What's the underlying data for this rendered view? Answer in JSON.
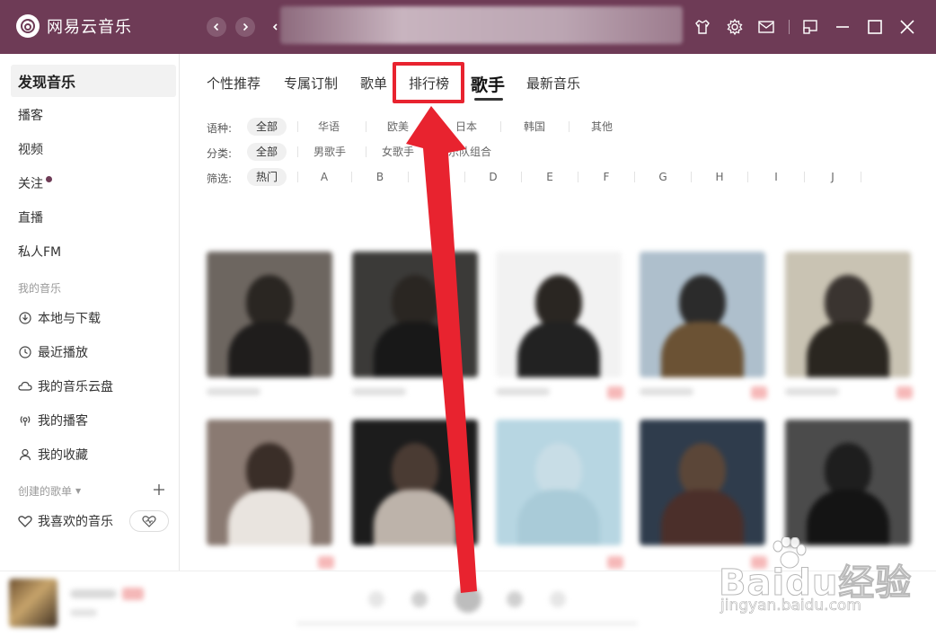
{
  "app": {
    "title": "网易云音乐"
  },
  "titlebar": {
    "icons": [
      "back-icon",
      "forward-icon",
      "skin-icon",
      "gear-icon",
      "mail-icon",
      "mini-mode-icon",
      "minimize-icon",
      "maximize-icon",
      "close-icon"
    ]
  },
  "sidebar": {
    "discover": "发现音乐",
    "items": [
      {
        "label": "播客"
      },
      {
        "label": "视频"
      },
      {
        "label": "关注"
      },
      {
        "label": "直播"
      },
      {
        "label": "私人FM"
      }
    ],
    "my_music_header": "我的音乐",
    "my_music": [
      {
        "label": "本地与下载",
        "icon": "download-icon"
      },
      {
        "label": "最近播放",
        "icon": "clock-icon"
      },
      {
        "label": "我的音乐云盘",
        "icon": "cloud-icon"
      },
      {
        "label": "我的播客",
        "icon": "podcast-icon"
      },
      {
        "label": "我的收藏",
        "icon": "person-icon"
      }
    ],
    "playlists_header": "创建的歌单",
    "favorite": "我喜欢的音乐"
  },
  "tabs": [
    {
      "label": "个性推荐"
    },
    {
      "label": "专属订制"
    },
    {
      "label": "歌单"
    },
    {
      "label": "排行榜"
    },
    {
      "label": "歌手"
    },
    {
      "label": "最新音乐"
    }
  ],
  "active_tab": "歌手",
  "highlighted_tab": "排行榜",
  "filters": {
    "language": {
      "label": "语种:",
      "options": [
        "全部",
        "华语",
        "欧美",
        "日本",
        "韩国",
        "其他"
      ]
    },
    "category": {
      "label": "分类:",
      "options": [
        "全部",
        "男歌手",
        "女歌手",
        "乐队组合"
      ]
    },
    "filter": {
      "label": "筛选:",
      "options": [
        "热门",
        "A",
        "B",
        "",
        "D",
        "E",
        "F",
        "G",
        "H",
        "I",
        "J"
      ]
    }
  },
  "watermark": {
    "main": "Baidu经验",
    "sub": "jingyan.baidu.com"
  },
  "colors": {
    "brand": "#6e3b56",
    "annotation": "#e8232f"
  }
}
